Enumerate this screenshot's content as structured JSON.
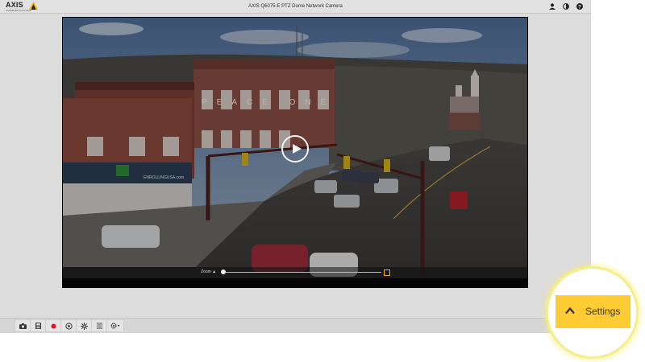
{
  "app": {
    "title": "AXIS Q6075-E PTZ Dome Network Camera",
    "logo": {
      "word": "AXIS",
      "tagline": "COMMUNICATIONS"
    },
    "toolbar_icons": [
      "user-icon",
      "contrast-icon",
      "help-icon"
    ]
  },
  "video": {
    "zoom_label": "Zoom ▲",
    "zoom_level": 0.0,
    "storefront_sign": "PEACE ONE",
    "shop_sign": "ENROLLINGUSA.com"
  },
  "statusbar": {
    "buttons": [
      "camera-icon",
      "save-icon",
      "record-icon",
      "ptz-icon",
      "focus-icon",
      "list-icon",
      "settings-gear-icon"
    ]
  },
  "settings": {
    "label": "Settings"
  },
  "colors": {
    "accent": "#ffcc33",
    "record": "#e0112b",
    "highlight": "#f6ee8a"
  }
}
